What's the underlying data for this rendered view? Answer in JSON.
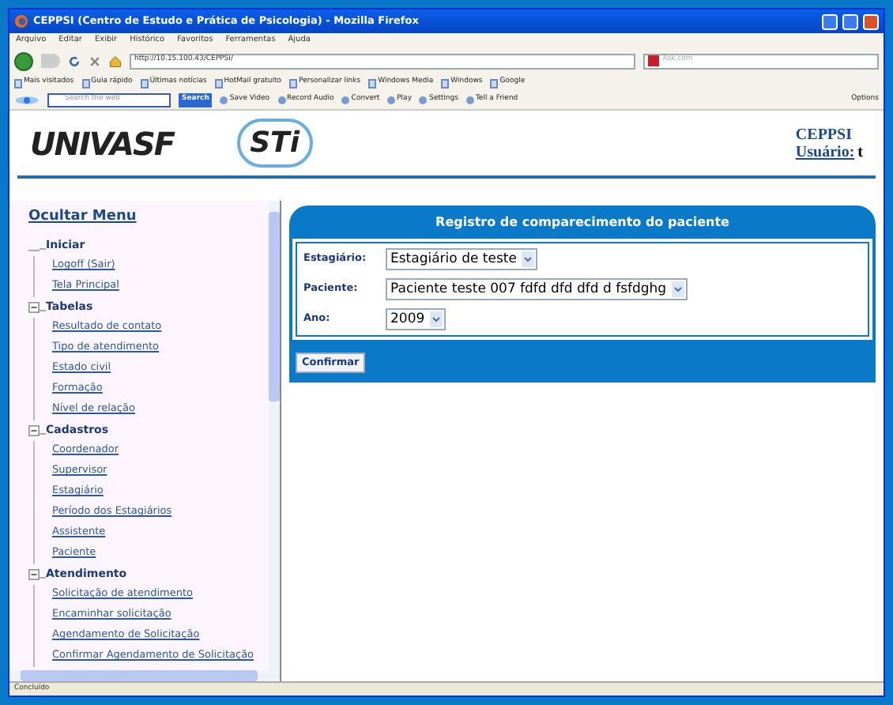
{
  "window": {
    "title": "CEPPSI (Centro de Estudo e Prática de Psicologia) - Mozilla Firefox"
  },
  "menu": [
    "Arquivo",
    "Editar",
    "Exibir",
    "Histórico",
    "Favoritos",
    "Ferramentas",
    "Ajuda"
  ],
  "navigation": {
    "url": "http://10.15.100.43/CEPPSI/",
    "search_placeholder": "Ask.com"
  },
  "bookmarks": [
    "Mais visitados",
    "Guia rápido",
    "Últimas notícias",
    "HotMail gratuito",
    "Personalizar links",
    "Windows Media",
    "Windows",
    "Google"
  ],
  "toolbar": {
    "search_placeholder": "Search the web",
    "search_button": "Search",
    "items": [
      "Save Video",
      "Record Audio",
      "Convert",
      "Play",
      "Settings",
      "Tell a Friend"
    ],
    "options": "Options"
  },
  "header": {
    "logos": [
      "UNIVASF",
      "STi"
    ],
    "site": "CEPPSI",
    "user_label": "Usuário:",
    "user": "t"
  },
  "sidebar": {
    "hide_menu": "Ocultar Menu",
    "groups": [
      {
        "label": "Iniciar",
        "collapsible": false,
        "expanded": true,
        "children": [
          "Logoff (Sair)",
          "Tela Principal"
        ]
      },
      {
        "label": "Tabelas",
        "collapsible": true,
        "expanded": true,
        "children": [
          "Resultado de contato",
          "Tipo de atendimento",
          "Estado civil",
          "Formação",
          "Nível de relação"
        ]
      },
      {
        "label": "Cadastros",
        "collapsible": true,
        "expanded": true,
        "children": [
          "Coordenador",
          "Supervisor",
          "Estagiário",
          "Período dos Estagiários",
          "Assistente",
          "Paciente"
        ]
      },
      {
        "label": "Atendimento",
        "collapsible": true,
        "expanded": true,
        "children": [
          "Solicitação de atendimento",
          "Encaminhar solicitação",
          "Agendamento de Solicitação",
          "Confirmar Agendamento de Solicitação"
        ]
      }
    ]
  },
  "form": {
    "title": "Registro de comparecimento do paciente",
    "fields": [
      {
        "label": "Estagiário:",
        "value": "Estagiário de teste"
      },
      {
        "label": "Paciente:",
        "value": "Paciente teste 007 fdfd dfd dfd d fsfdghg"
      },
      {
        "label": "Ano:",
        "value": "2009"
      }
    ],
    "submit": "Confirmar"
  },
  "status_bar": "Concluído"
}
